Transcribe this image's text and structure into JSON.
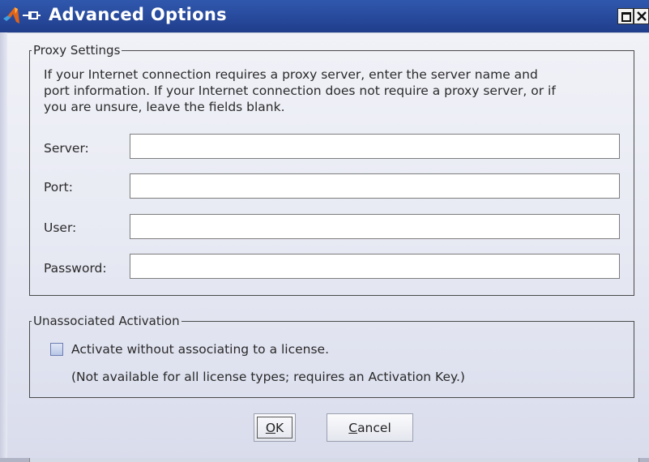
{
  "window": {
    "title": "Advanced Options"
  },
  "proxy": {
    "legend": "Proxy Settings",
    "description_lines": [
      "If your Internet connection requires a proxy server, enter the server name and",
      "port information. If your Internet connection does not require a proxy server, or if",
      "you are unsure, leave the fields blank."
    ],
    "fields": [
      {
        "label": "Server:",
        "value": "",
        "placeholder": ""
      },
      {
        "label": "Port:",
        "value": "",
        "placeholder": ""
      },
      {
        "label": "User:",
        "value": "",
        "placeholder": ""
      },
      {
        "label": "Password:",
        "value": "",
        "placeholder": ""
      }
    ]
  },
  "unassociated": {
    "legend": "Unassociated Activation",
    "checkbox_label": "Activate without associating to a license.",
    "checked": false,
    "note": "(Not available for all license types; requires an Activation Key.)"
  },
  "buttons": {
    "ok_mnemonic": "O",
    "ok_rest": "K",
    "cancel_mnemonic": "C",
    "cancel_rest": "ancel"
  },
  "colors": {
    "titlebar": "#27489a",
    "title_text": "#ffffff",
    "dialog_background": "#e9ebf4"
  },
  "icons": [
    "app-logo-icon",
    "pin-icon",
    "maximize-icon",
    "close-icon"
  ]
}
